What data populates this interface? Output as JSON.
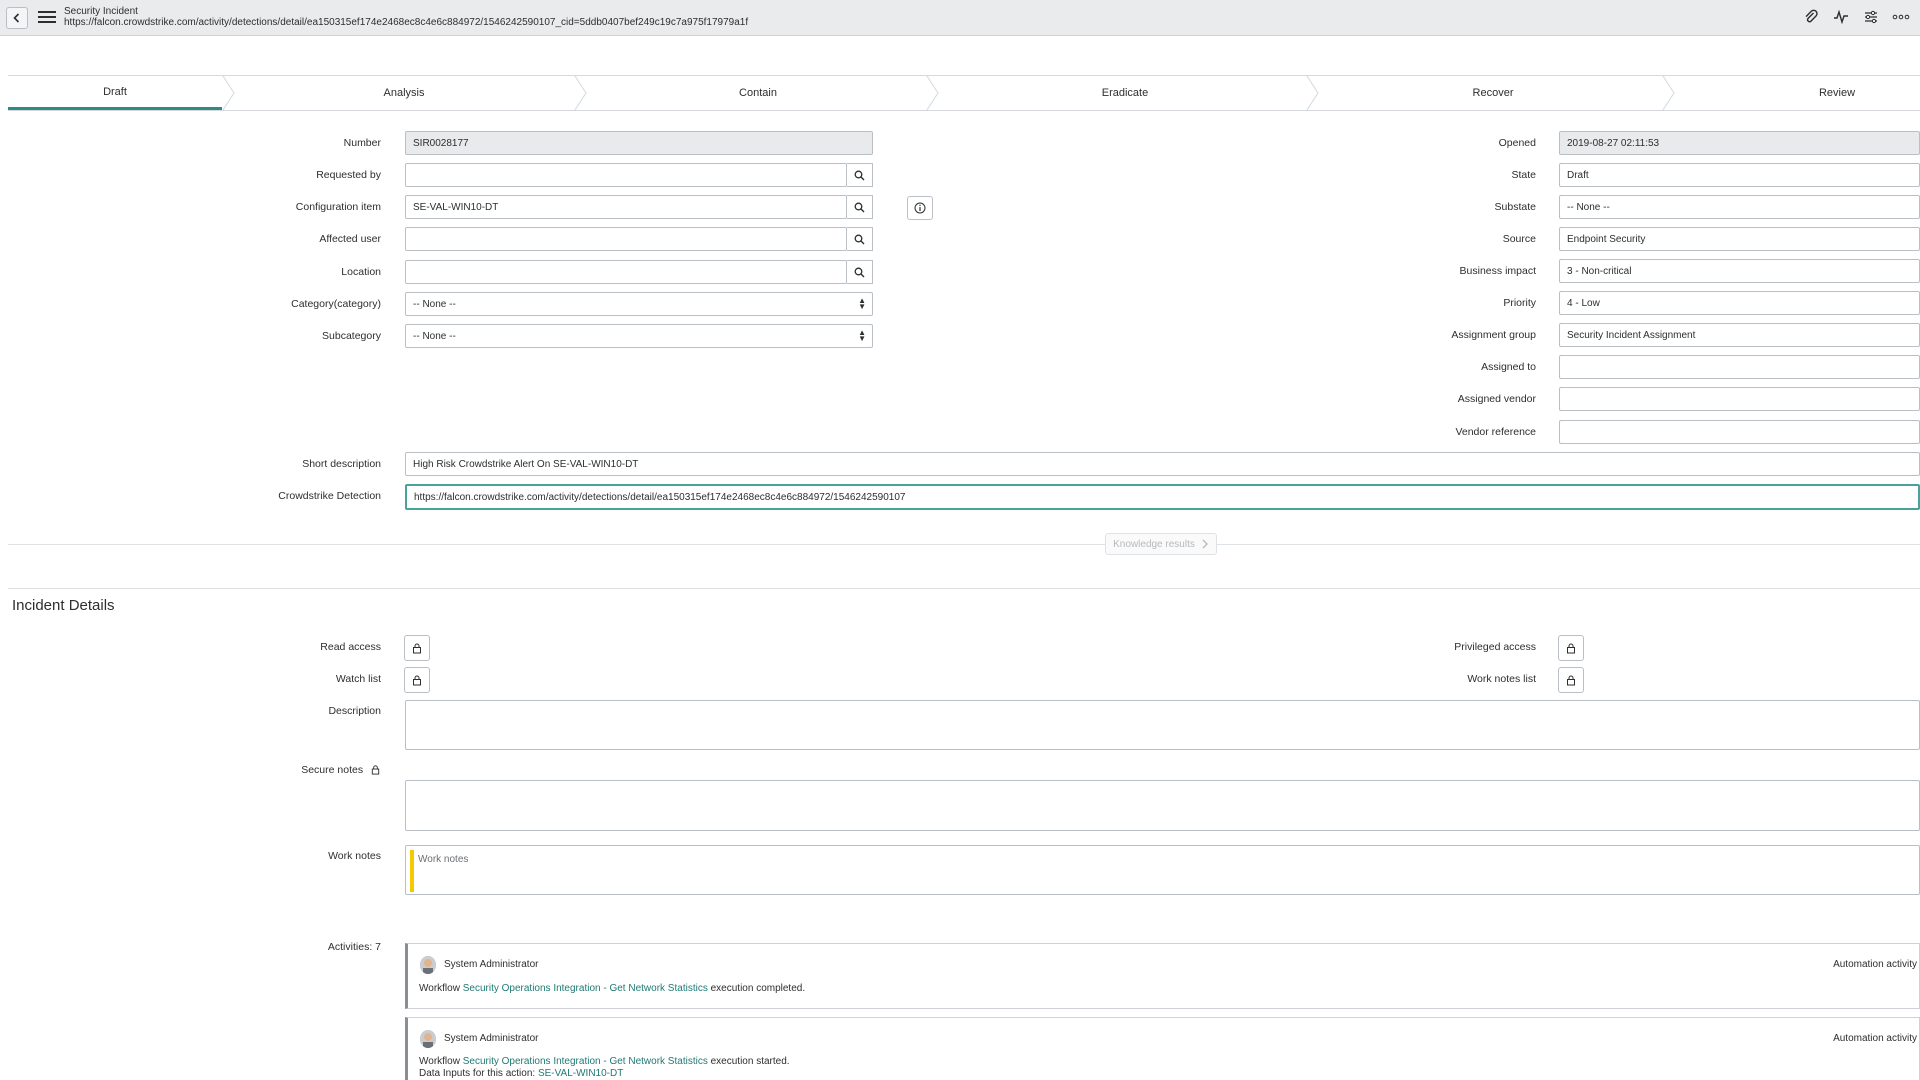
{
  "header": {
    "title": "Security Incident",
    "url": "https://falcon.crowdstrike.com/activity/detections/detail/ea150315ef174e2468ec8c4e6c884972/1546242590107_cid=5ddb0407bef249c19c7a975f17979a1f"
  },
  "flow": {
    "steps": [
      {
        "label": "Draft"
      },
      {
        "label": "Analysis"
      },
      {
        "label": "Contain"
      },
      {
        "label": "Eradicate"
      },
      {
        "label": "Recover"
      },
      {
        "label": "Review"
      }
    ],
    "active_index": 0
  },
  "form": {
    "number": {
      "label": "Number",
      "value": "SIR0028177"
    },
    "requested_by": {
      "label": "Requested by",
      "value": ""
    },
    "configuration_item": {
      "label": "Configuration item",
      "value": "SE-VAL-WIN10-DT"
    },
    "affected_user": {
      "label": "Affected user",
      "value": ""
    },
    "location": {
      "label": "Location",
      "value": ""
    },
    "category": {
      "label": "Category(category)",
      "value": "-- None --"
    },
    "subcategory": {
      "label": "Subcategory",
      "value": "-- None --"
    },
    "opened": {
      "label": "Opened",
      "value": "2019-08-27 02:11:53"
    },
    "state": {
      "label": "State",
      "value": "Draft"
    },
    "substate": {
      "label": "Substate",
      "value": "-- None --"
    },
    "source": {
      "label": "Source",
      "value": "Endpoint Security"
    },
    "business_impact": {
      "label": "Business impact",
      "value": "3 - Non-critical"
    },
    "priority": {
      "label": "Priority",
      "value": "4 - Low"
    },
    "assignment_group": {
      "label": "Assignment group",
      "value": "Security Incident Assignment"
    },
    "assigned_to": {
      "label": "Assigned to",
      "value": ""
    },
    "assigned_vendor": {
      "label": "Assigned vendor",
      "value": ""
    },
    "vendor_reference": {
      "label": "Vendor reference",
      "value": ""
    },
    "short_description": {
      "label": "Short description",
      "value": "High Risk Crowdstrike Alert On SE-VAL-WIN10-DT"
    },
    "crowdstrike_detection": {
      "label": "Crowdstrike Detection",
      "value": "https://falcon.crowdstrike.com/activity/detections/detail/ea150315ef174e2468ec8c4e6c884972/1546242590107"
    }
  },
  "knowledge": {
    "label": "Knowledge results"
  },
  "details": {
    "section_title": "Incident Details",
    "read_access": "Read access",
    "watch_list": "Watch list",
    "privileged_access": "Privileged access",
    "work_notes_list": "Work notes list",
    "description": "Description",
    "secure_notes": "Secure notes",
    "work_notes": "Work notes",
    "work_notes_placeholder": "Work notes",
    "activities_label": "Activities: 7"
  },
  "activities": [
    {
      "author": "System Administrator",
      "type": "Automation activity",
      "prefix": "Workflow ",
      "link": "Security Operations Integration - Get Network Statistics",
      "suffix": " execution completed."
    },
    {
      "author": "System Administrator",
      "type": "Automation activity",
      "prefix": "Workflow ",
      "link": "Security Operations Integration - Get Network Statistics",
      "suffix": " execution started.",
      "inputs_prefix": "Data Inputs for this action: ",
      "inputs_link": "SE-VAL-WIN10-DT"
    }
  ],
  "colors": {
    "accent": "#2f8a84",
    "worknote_bar": "#f5c800",
    "link": "#1f7a73"
  }
}
